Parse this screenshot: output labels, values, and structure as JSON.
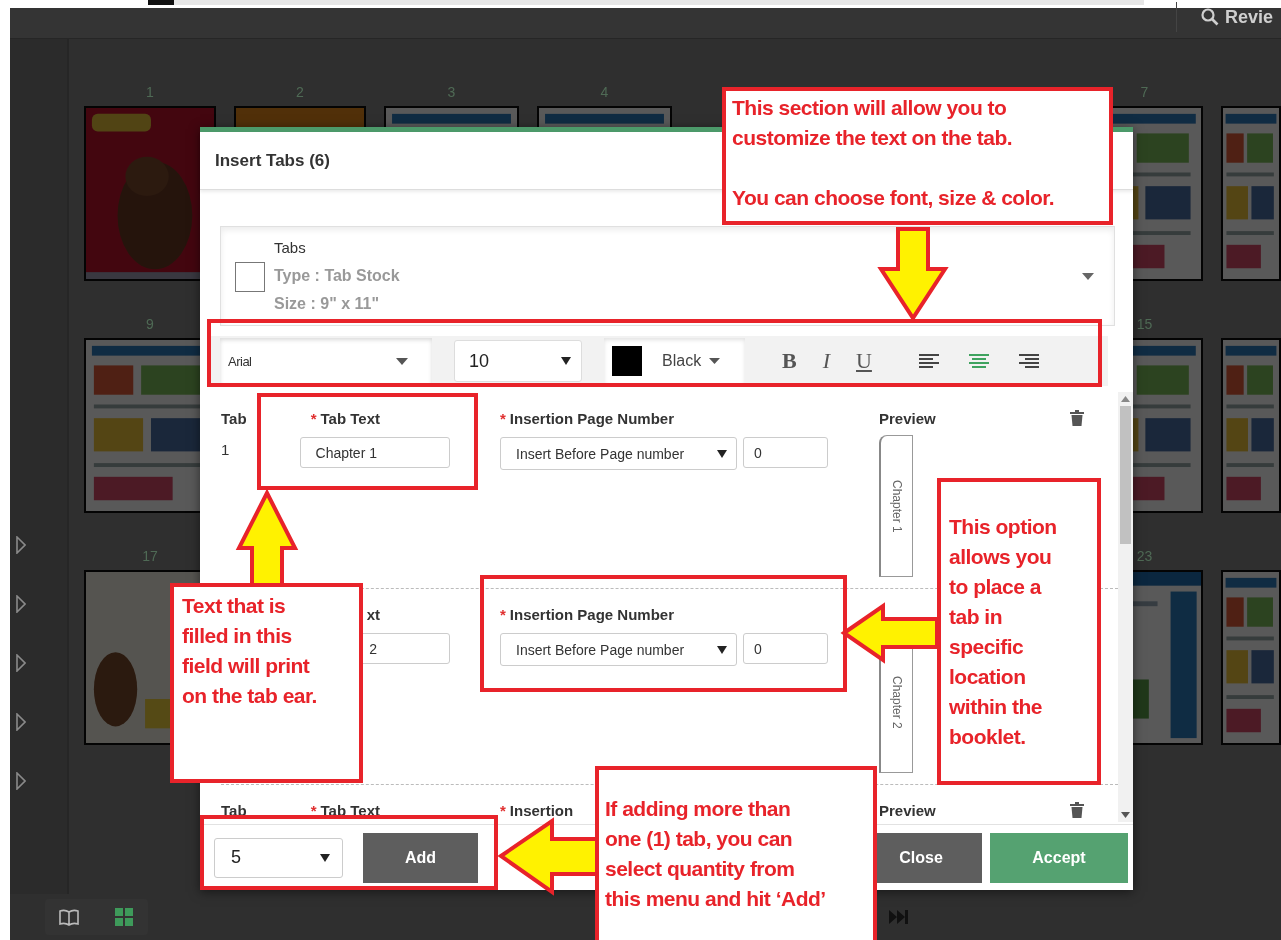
{
  "app_bar": {
    "search_label": "Revie"
  },
  "page_numbers": [
    "1",
    "2",
    "3",
    "4",
    "7",
    "9",
    "15",
    "17",
    "23"
  ],
  "dialog": {
    "title": "Insert Tabs (6)",
    "stock": {
      "checked": false,
      "name": "Tabs",
      "type": "Type : Tab Stock",
      "size": "Size : 9\" x 11\""
    },
    "format": {
      "font": "Arial",
      "size": "10",
      "color_name": "Black",
      "styles": [
        {
          "label": "B",
          "kind": "bold"
        },
        {
          "label": "I",
          "kind": "italic"
        },
        {
          "label": "U",
          "kind": "underline"
        }
      ],
      "alignments": [
        {
          "kind": "left",
          "selected": false
        },
        {
          "kind": "center",
          "selected": true
        },
        {
          "kind": "right",
          "selected": false
        }
      ]
    },
    "rows": [
      {
        "tab_label": "Tab",
        "tab_number": "1",
        "text_label": {
          "mark": "*",
          "text": "Tab Text"
        },
        "text_value": "Chapter 1",
        "page_label": {
          "mark": "*",
          "text": "Insertion Page Number"
        },
        "page_mode": "Insert Before Page number",
        "page_number": "0",
        "preview_label": "Preview",
        "preview_text": "Chapter 1",
        "deletable": true
      },
      {
        "text_label": {
          "text": "xt"
        },
        "text_value": "2",
        "page_label": {
          "mark": "*",
          "text": "Insertion Page Number"
        },
        "page_mode": "Insert Before Page number",
        "page_number": "0",
        "preview_text": "Chapter 2",
        "deletable": false
      },
      {
        "tab_label": "Tab",
        "text_label": {
          "mark": "*",
          "text": "Tab Text"
        },
        "page_label": {
          "mark": "*",
          "text": "Insertion"
        },
        "preview_label": "Preview",
        "deletable": true
      }
    ],
    "footer": {
      "quantity": "5",
      "add": "Add",
      "close": "Close",
      "accept": "Accept"
    }
  },
  "callouts": [
    {
      "paragraphs": [
        [
          "This section will allow you to",
          "customize the text on the tab."
        ],
        [
          "You can choose font, size & color."
        ]
      ]
    },
    {
      "paragraphs": [
        [
          "Text that is",
          "filled in this",
          "field will print",
          "on the tab ear."
        ]
      ]
    },
    {
      "paragraphs": [
        [
          "This option",
          "allows you",
          "to place a",
          "tab in",
          "specific",
          "location",
          "within the",
          "booklet."
        ]
      ]
    },
    {
      "paragraphs": [
        [
          "If adding more than",
          "one (1) tab, you can",
          "select quantity from",
          "this menu and hit ‘Add’"
        ]
      ]
    }
  ]
}
